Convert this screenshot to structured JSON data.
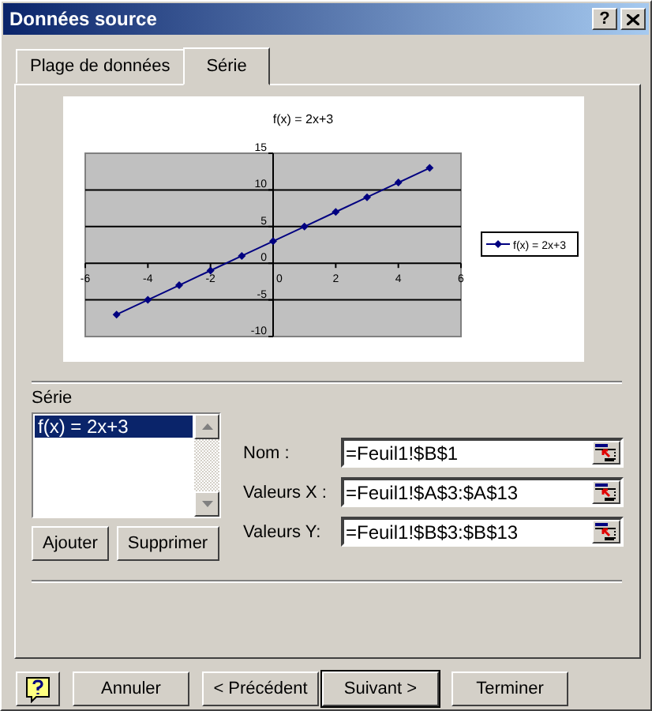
{
  "window": {
    "title": "Données source",
    "help_button": "?"
  },
  "tabs": [
    {
      "label": "Plage de données",
      "selected": false
    },
    {
      "label": "Série",
      "selected": true
    }
  ],
  "chart_preview": {
    "chart_data": {
      "type": "line",
      "grid": true,
      "title": "f(x) = 2x+3",
      "x": [
        -5,
        -4,
        -3,
        -2,
        -1,
        0,
        1,
        2,
        3,
        4,
        5
      ],
      "series": [
        {
          "name": "f(x) = 2x+3",
          "color": "#000080",
          "marker": "diamond",
          "values": [
            -7,
            -5,
            -3,
            -1,
            1,
            3,
            5,
            7,
            9,
            11,
            13
          ]
        }
      ],
      "xlim": [
        -6,
        6
      ],
      "ylim": [
        -10,
        15
      ],
      "xticks": [
        -6,
        -4,
        -2,
        0,
        2,
        4,
        6
      ],
      "yticks": [
        -10,
        -5,
        0,
        5,
        10,
        15
      ]
    }
  },
  "series_list": {
    "label": "Série",
    "items": [
      {
        "label": "f(x) = 2x+3",
        "selected": true
      }
    ]
  },
  "fields": [
    {
      "label": "Nom :",
      "value": "=Feuil1!$B$1"
    },
    {
      "label": "Valeurs X :",
      "value": "=Feuil1!$A$3:$A$13"
    },
    {
      "label": "Valeurs Y:",
      "value": "=Feuil1!$B$3:$B$13"
    }
  ],
  "series_buttons": [
    "Ajouter",
    "Supprimer"
  ],
  "footer_buttons": [
    {
      "label": "Annuler",
      "focused": false
    },
    {
      "label": "< Précédent",
      "focused": false
    },
    {
      "label": "Suivant >",
      "focused": true
    },
    {
      "label": "Terminer",
      "focused": false
    }
  ]
}
